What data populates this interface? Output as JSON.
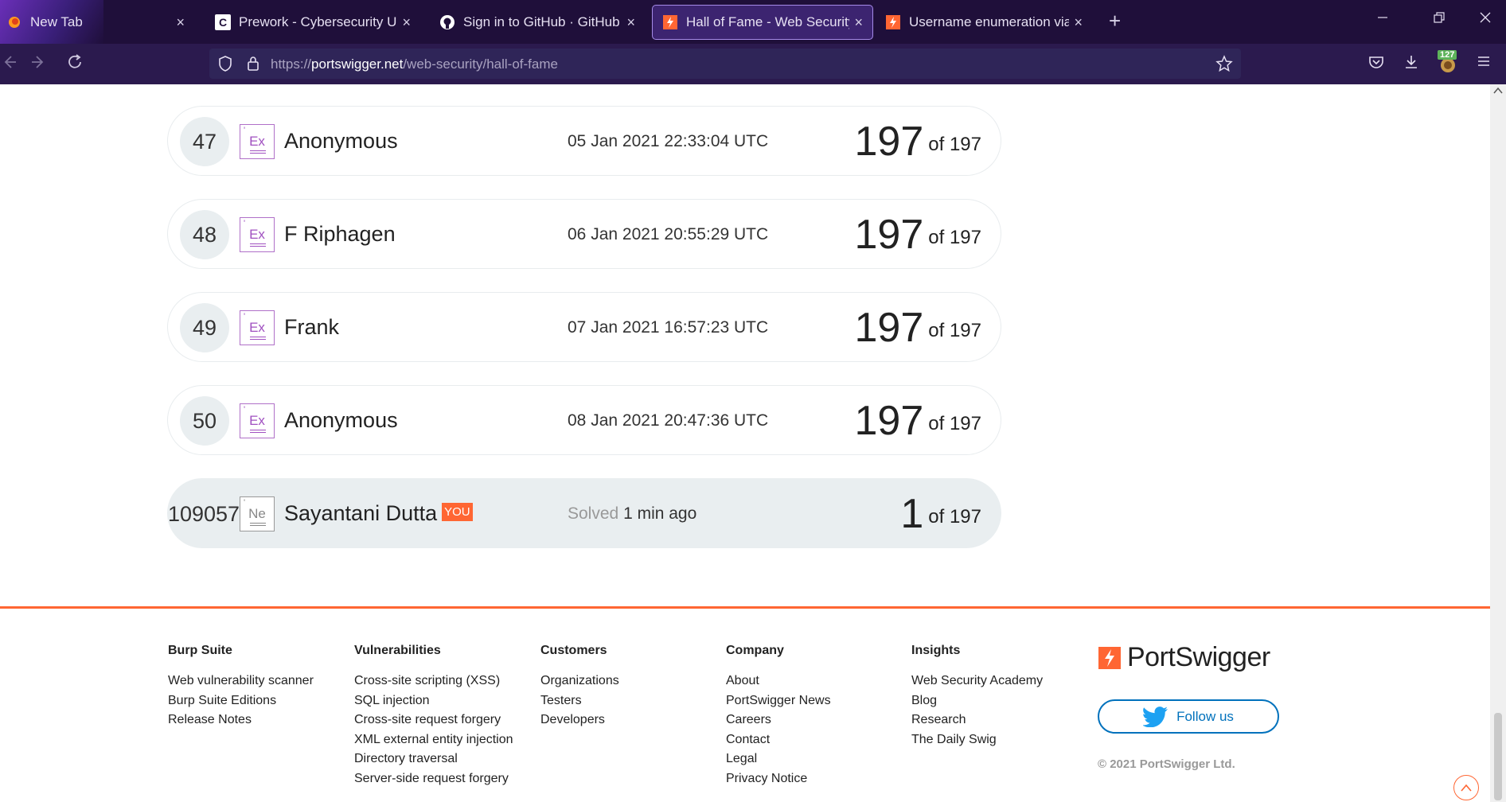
{
  "browser": {
    "tabs": [
      {
        "title": "New Tab",
        "close": "×"
      },
      {
        "title": "Prework - Cybersecurity Universi",
        "close": "×"
      },
      {
        "title": "Sign in to GitHub · GitHub",
        "close": "×"
      },
      {
        "title": "Hall of Fame - Web Security Ac",
        "close": "×"
      },
      {
        "title": "Username enumeration via diffe",
        "close": "×"
      }
    ],
    "new_tab": "+",
    "url_prefix": "https://",
    "url_host": "portswigger.net",
    "url_path": "/web-security/hall-of-fame",
    "extension_badge": "127"
  },
  "hall_of_fame": {
    "rows": [
      {
        "rank": "47",
        "level": "Ex",
        "name": "Anonymous",
        "time": "05 Jan 2021 22:33:04 UTC",
        "solved": "197",
        "total_text": "of 197"
      },
      {
        "rank": "48",
        "level": "Ex",
        "name": "F Riphagen",
        "time": "06 Jan 2021 20:55:29 UTC",
        "solved": "197",
        "total_text": "of 197"
      },
      {
        "rank": "49",
        "level": "Ex",
        "name": "Frank",
        "time": "07 Jan 2021 16:57:23 UTC",
        "solved": "197",
        "total_text": "of 197"
      },
      {
        "rank": "50",
        "level": "Ex",
        "name": "Anonymous",
        "time": "08 Jan 2021 20:47:36 UTC",
        "solved": "197",
        "total_text": "of 197"
      }
    ],
    "current_user": {
      "rank": "109057",
      "level": "Ne",
      "name": "Sayantani Dutta",
      "you_label": "YOU",
      "time_prefix": "Solved",
      "time": "1 min ago",
      "solved": "1",
      "total_text": "of 197"
    }
  },
  "footer": {
    "columns": [
      {
        "heading": "Burp Suite",
        "links": [
          "Web vulnerability scanner",
          "Burp Suite Editions",
          "Release Notes"
        ]
      },
      {
        "heading": "Vulnerabilities",
        "links": [
          "Cross-site scripting (XSS)",
          "SQL injection",
          "Cross-site request forgery",
          "XML external entity injection",
          "Directory traversal",
          "Server-side request forgery"
        ]
      },
      {
        "heading": "Customers",
        "links": [
          "Organizations",
          "Testers",
          "Developers"
        ]
      },
      {
        "heading": "Company",
        "links": [
          "About",
          "PortSwigger News",
          "Careers",
          "Contact",
          "Legal",
          "Privacy Notice"
        ]
      },
      {
        "heading": "Insights",
        "links": [
          "Web Security Academy",
          "Blog",
          "Research",
          "The Daily Swig"
        ]
      }
    ],
    "brand": "PortSwigger",
    "follow_label": "Follow us",
    "copyright": "© 2021 PortSwigger Ltd."
  },
  "colors": {
    "accent": "#ff6633",
    "twitter_blue": "#0071bc",
    "expert_badge": "#b070c8",
    "browser_bg": "#1f0f3a"
  }
}
